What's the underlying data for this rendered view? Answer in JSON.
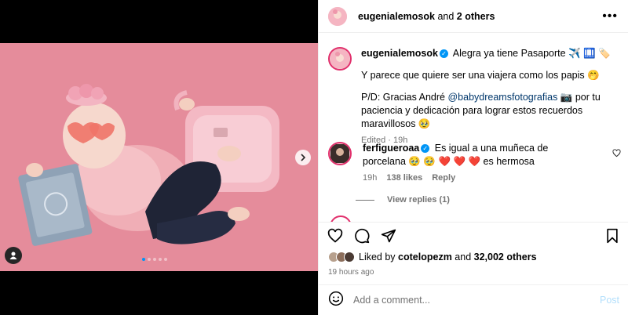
{
  "header": {
    "username": "eugenialemosok",
    "and_text": "and",
    "others": "2 others",
    "more_icon": "more-horizontal-icon"
  },
  "caption": {
    "username": "eugenialemosok",
    "line1": "Alegra ya tiene Pasaporte ✈️ 🛄 🏷️",
    "line2": "Y parece que quiere ser una viajera como los papis 🤭",
    "line3_prefix": "P/D: Gracias André",
    "mention": "@babydreamsfotografias",
    "line3_suffix": "📷 por tu paciencia y dedicación para lograr estos recuerdos maravillosos 🥹",
    "edited": "Edited · 19h"
  },
  "comment": {
    "username": "ferfigueroaa",
    "text": "Es igual a una muñeca de porcelana 🥹 🥹 ❤️ ❤️ ❤️ es hermosa",
    "time": "19h",
    "likes": "138 likes",
    "reply": "Reply",
    "view_replies": "View replies (1)"
  },
  "likes": {
    "prefix": "Liked by",
    "user": "cotelopezm",
    "and_text": "and",
    "others": "32,002 others"
  },
  "timestamp": "19 hours ago",
  "add_comment": {
    "placeholder": "Add a comment...",
    "post_label": "Post"
  },
  "carousel": {
    "total": 5,
    "active": 1
  },
  "colors": {
    "accent": "#0095f6",
    "mention": "#00376b",
    "muted": "#737373",
    "post_disabled": "#b2dffc",
    "photo_bg": "#e48a99"
  }
}
